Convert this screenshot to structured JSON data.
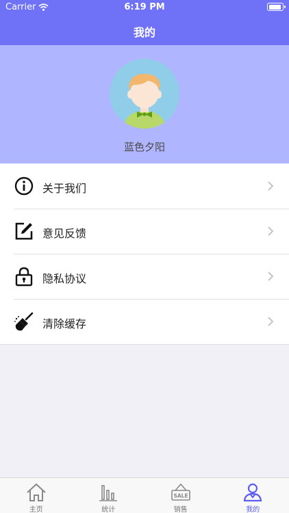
{
  "status_bar": {
    "carrier": "Carrier",
    "time": "6:19 PM"
  },
  "nav": {
    "title": "我的"
  },
  "profile": {
    "username": "蓝色夕阳"
  },
  "menu": [
    {
      "label": "关于我们",
      "icon": "info-icon"
    },
    {
      "label": "意见反馈",
      "icon": "edit-icon"
    },
    {
      "label": "隐私协议",
      "icon": "lock-icon"
    },
    {
      "label": "清除缓存",
      "icon": "broom-icon"
    }
  ],
  "tabs": [
    {
      "label": "主页",
      "icon": "home-icon"
    },
    {
      "label": "统计",
      "icon": "bar-chart-icon"
    },
    {
      "label": "销售",
      "icon": "sale-sign-icon",
      "sign_text": "SALE"
    },
    {
      "label": "我的",
      "icon": "user-icon",
      "active": true
    }
  ],
  "colors": {
    "accent": "#6f72f7",
    "profile_bg": "#b0b5ff",
    "active_tab": "#5b5ef2"
  }
}
